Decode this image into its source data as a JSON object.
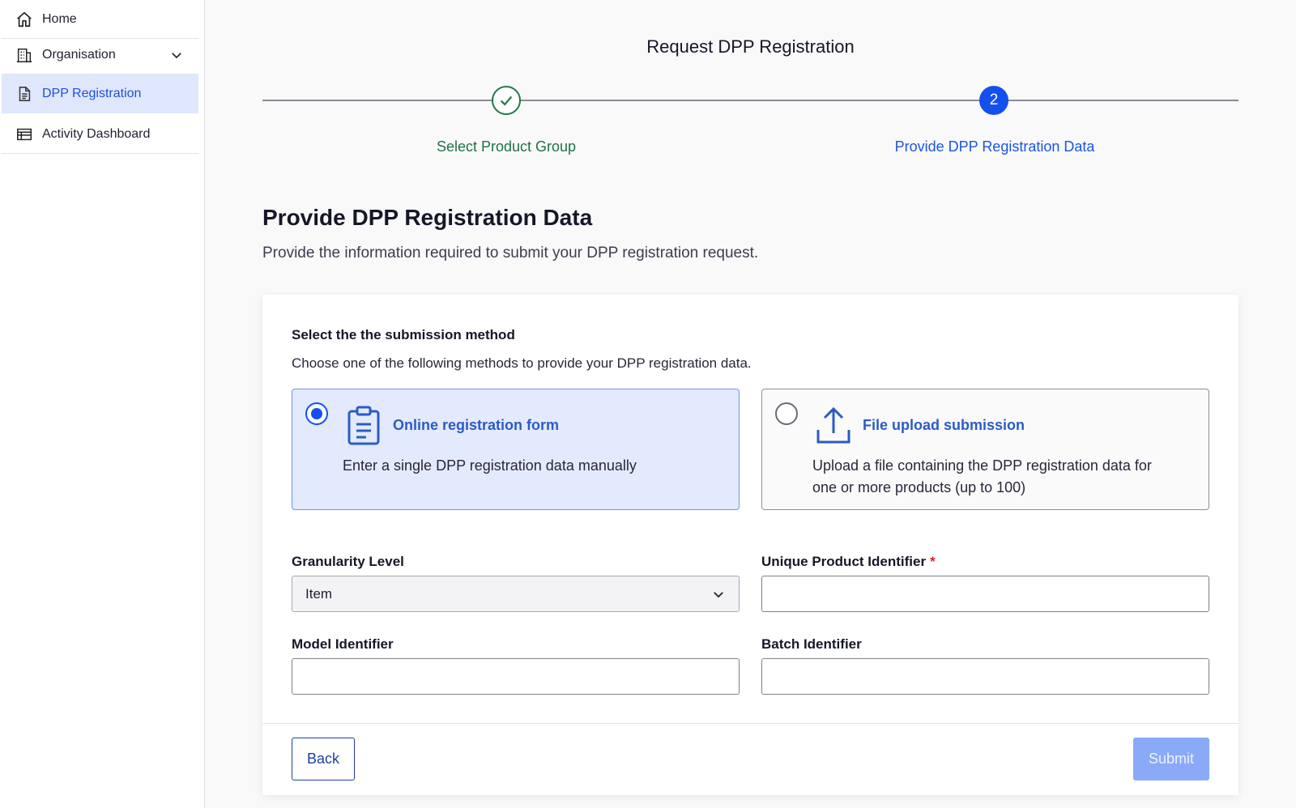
{
  "sidebar": {
    "items": [
      {
        "label": "Home",
        "icon": "home-icon"
      },
      {
        "label": "Organisation",
        "icon": "building-icon"
      },
      {
        "label": "DPP Registration",
        "icon": "document-icon",
        "active": true
      },
      {
        "label": "Activity Dashboard",
        "icon": "table-icon"
      }
    ]
  },
  "header": {
    "title": "Request DPP Registration"
  },
  "stepper": {
    "steps": [
      {
        "label": "Select Product Group",
        "status": "complete"
      },
      {
        "number": "2",
        "label": "Provide DPP Registration Data",
        "status": "current"
      }
    ]
  },
  "section": {
    "title": "Provide DPP Registration Data",
    "description": "Provide the information required to submit your DPP registration request."
  },
  "submission": {
    "label": "Select the the submission method",
    "sublabel": "Choose one of the following methods to provide your DPP registration data.",
    "options": [
      {
        "title": "Online registration form",
        "description": "Enter a single DPP registration data manually",
        "selected": true,
        "icon": "clipboard-icon"
      },
      {
        "title": "File upload submission",
        "description_line1": "Upload a file containing the DPP registration data for",
        "description_line2": "one or more products (up to 100)",
        "selected": false,
        "icon": "upload-icon"
      }
    ]
  },
  "form": {
    "granularity_label": "Granularity Level",
    "granularity_value": "Item",
    "upi_label": "Unique Product Identifier",
    "upi_required": "*",
    "upi_value": "",
    "model_label": "Model Identifier",
    "model_value": "",
    "batch_label": "Batch Identifier",
    "batch_value": ""
  },
  "actions": {
    "back": "Back",
    "submit": "Submit"
  },
  "colors": {
    "primary": "#1450ee",
    "success": "#1f7147",
    "active_bg": "#dfe7fd"
  }
}
